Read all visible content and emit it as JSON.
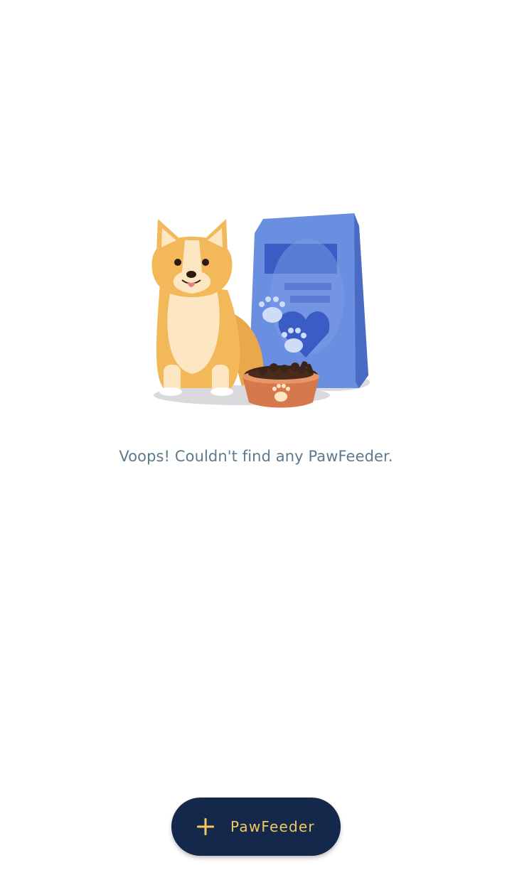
{
  "empty_state": {
    "message": "Voops! Couldn't find any PawFeeder.",
    "illustration": "corgi-with-food-bag-and-bowl"
  },
  "fab": {
    "label": "PawFeeder",
    "icon": "plus-icon"
  },
  "colors": {
    "message_text": "#5e7a8a",
    "fab_background": "#13284a",
    "fab_accent": "#f4c860",
    "food_bag": "#5b7fd4",
    "corgi_fur": "#f2b85a",
    "bowl": "#d5794c"
  }
}
